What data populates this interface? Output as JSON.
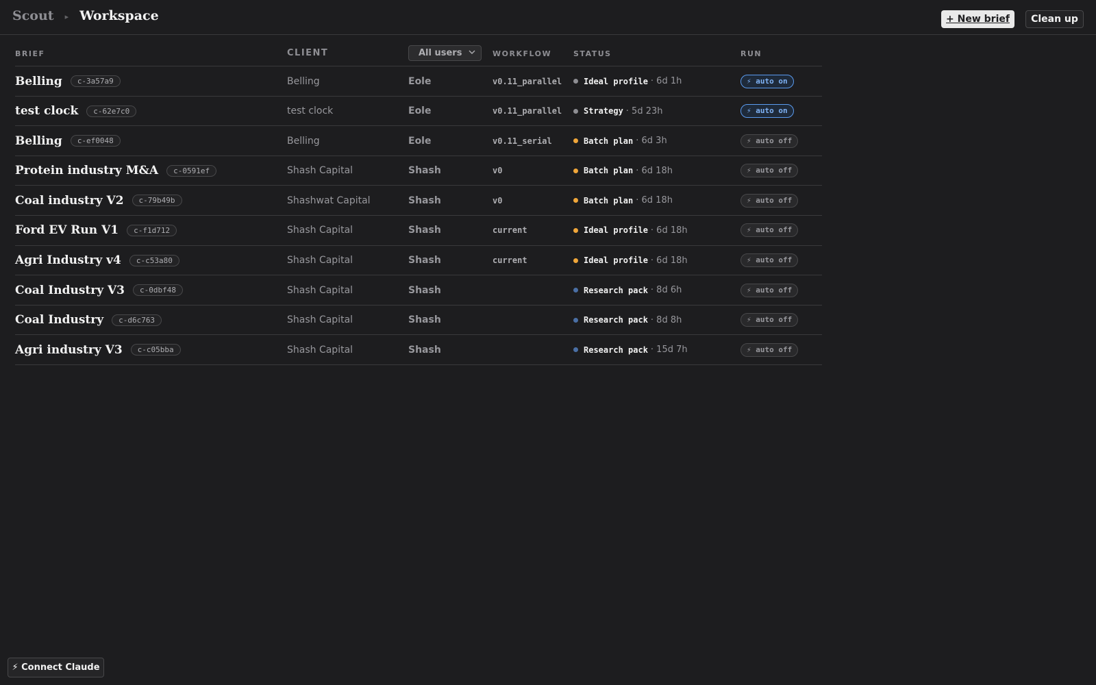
{
  "breadcrumb": {
    "root": "Scout",
    "separator": "▸",
    "current": "Workspace"
  },
  "toolbar": {
    "new_brief_label": "+ New brief",
    "clean_up_label": "Clean up"
  },
  "table": {
    "columns": {
      "brief": "BRIEF",
      "client": "CLIENT",
      "workflow": "WORKFLOW",
      "status": "STATUS",
      "run": "RUN"
    },
    "user_filter": {
      "selected": "All users"
    },
    "rows": [
      {
        "title": "Belling",
        "id": "c-3a57a9",
        "client": "Belling",
        "user": "Eole",
        "workflow": "v0.11_parallel",
        "status_color": "#8e8e93",
        "status": "Ideal profile",
        "age": "· 6d 1h",
        "run": "⚡ auto on",
        "run_on": true
      },
      {
        "title": "test clock",
        "id": "c-62e7c0",
        "client": "test clock",
        "user": "Eole",
        "workflow": "v0.11_parallel",
        "status_color": "#8e8e93",
        "status": "Strategy",
        "age": "· 5d 23h",
        "run": "⚡ auto on",
        "run_on": true
      },
      {
        "title": "Belling",
        "id": "c-ef0048",
        "client": "Belling",
        "user": "Eole",
        "workflow": "v0.11_serial",
        "status_color": "#f0a63a",
        "status": "Batch plan",
        "age": "· 6d 3h",
        "run": "⚡ auto off",
        "run_on": false
      },
      {
        "title": "Protein industry M&A",
        "id": "c-0591ef",
        "client": "Shash Capital",
        "user": "Shash",
        "workflow": "v0",
        "status_color": "#f0a63a",
        "status": "Batch plan",
        "age": "· 6d 18h",
        "run": "⚡ auto off",
        "run_on": false
      },
      {
        "title": "Coal industry V2",
        "id": "c-79b49b",
        "client": "Shashwat Capital",
        "user": "Shash",
        "workflow": "v0",
        "status_color": "#f0a63a",
        "status": "Batch plan",
        "age": "· 6d 18h",
        "run": "⚡ auto off",
        "run_on": false
      },
      {
        "title": "Ford EV Run V1",
        "id": "c-f1d712",
        "client": "Shash Capital",
        "user": "Shash",
        "workflow": "current",
        "status_color": "#f0a63a",
        "status": "Ideal profile",
        "age": "· 6d 18h",
        "run": "⚡ auto off",
        "run_on": false
      },
      {
        "title": "Agri Industry v4",
        "id": "c-c53a80",
        "client": "Shash Capital",
        "user": "Shash",
        "workflow": "current",
        "status_color": "#f0a63a",
        "status": "Ideal profile",
        "age": "· 6d 18h",
        "run": "⚡ auto off",
        "run_on": false
      },
      {
        "title": "Coal Industry V3",
        "id": "c-0dbf48",
        "client": "Shash Capital",
        "user": "Shash",
        "workflow": "",
        "status_color": "#4a6fa5",
        "status": "Research pack",
        "age": "· 8d 6h",
        "run": "⚡ auto off",
        "run_on": false
      },
      {
        "title": "Coal Industry",
        "id": "c-d6c763",
        "client": "Shash Capital",
        "user": "Shash",
        "workflow": "",
        "status_color": "#4a6fa5",
        "status": "Research pack",
        "age": "· 8d 8h",
        "run": "⚡ auto off",
        "run_on": false
      },
      {
        "title": "Agri industry V3",
        "id": "c-c05bba",
        "client": "Shash Capital",
        "user": "Shash",
        "workflow": "",
        "status_color": "#4a6fa5",
        "status": "Research pack",
        "age": "· 15d 7h",
        "run": "⚡ auto off",
        "run_on": false
      }
    ]
  },
  "footer": {
    "connect_label": "⚡ Connect Claude"
  },
  "icons": {
    "select_chevron": "chevron-down-icon"
  }
}
